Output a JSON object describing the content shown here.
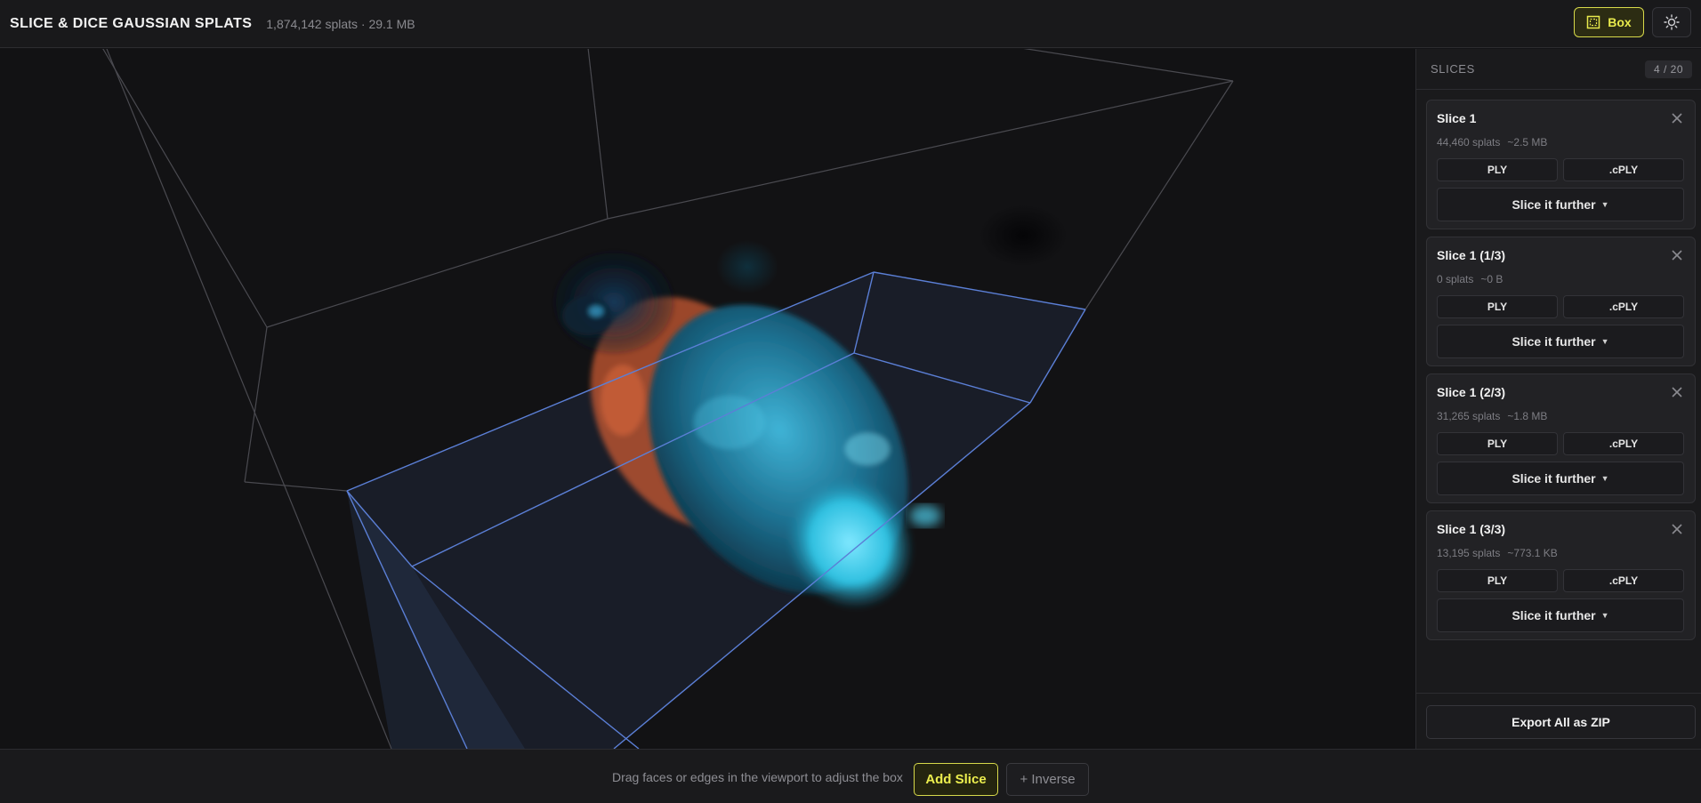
{
  "header": {
    "title": "SLICE & DICE GAUSSIAN SPLATS",
    "stats": "1,874,142 splats · 29.1 MB",
    "box_label": "Box",
    "box_icon": "box-select-icon",
    "theme_icon": "sun-icon"
  },
  "sidebar": {
    "title": "SLICES",
    "count": "4 / 20",
    "slices": [
      {
        "name": "Slice 1",
        "splats": "44,460 splats",
        "size": "~2.5 MB",
        "ply": "PLY",
        "cply": ".cPLY",
        "further": "Slice it further"
      },
      {
        "name": "Slice 1 (1/3)",
        "splats": "0 splats",
        "size": "~0 B",
        "ply": "PLY",
        "cply": ".cPLY",
        "further": "Slice it further"
      },
      {
        "name": "Slice 1 (2/3)",
        "splats": "31,265 splats",
        "size": "~1.8 MB",
        "ply": "PLY",
        "cply": ".cPLY",
        "further": "Slice it further"
      },
      {
        "name": "Slice 1 (3/3)",
        "splats": "13,195 splats",
        "size": "~773.1 KB",
        "ply": "PLY",
        "cply": ".cPLY",
        "further": "Slice it further"
      }
    ],
    "export_label": "Export All as ZIP"
  },
  "footer": {
    "hint": "Drag faces or edges in the viewport to adjust the box",
    "add_slice": "Add Slice",
    "inverse": "+ Inverse"
  },
  "colors": {
    "accent": "#e8ea4c",
    "background": "#141416",
    "box_edge": "#5b7fd6",
    "splat_cyan": "#3fc6e6",
    "splat_orange": "#d9673a"
  }
}
